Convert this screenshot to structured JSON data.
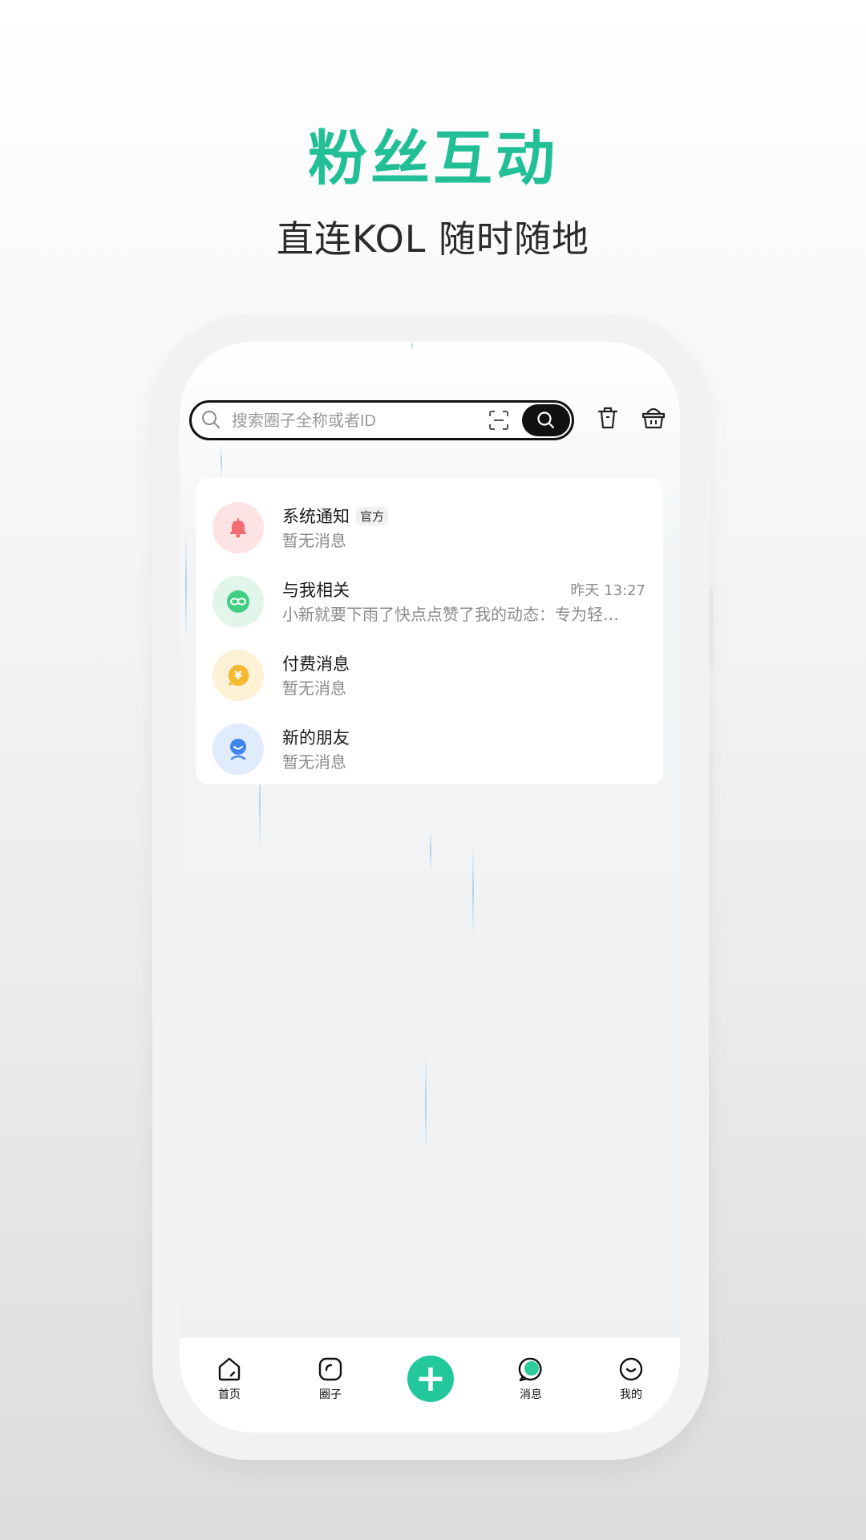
{
  "headline": "粉丝互动",
  "subheadline": "直连KOL  随时随地",
  "search": {
    "placeholder": "搜索圈子全称或者ID"
  },
  "icons": {
    "search": "search-icon",
    "scan": "scan-icon",
    "trash": "trash-icon",
    "basket": "basket-icon"
  },
  "messages": [
    {
      "title": "系统通知",
      "tag": "官方",
      "subtitle": "暂无消息",
      "time": "",
      "icon": "bell-icon",
      "color": "#fde3e4"
    },
    {
      "title": "与我相关",
      "tag": "",
      "subtitle": "小新就要下雨了快点点赞了我的动态：专为轻…",
      "time": "昨天 13:27",
      "icon": "link-icon",
      "color": "#e2f5ea"
    },
    {
      "title": "付费消息",
      "tag": "",
      "subtitle": "暂无消息",
      "time": "",
      "icon": "coin-icon",
      "color": "#fdf1d6"
    },
    {
      "title": "新的朋友",
      "tag": "",
      "subtitle": "暂无消息",
      "time": "",
      "icon": "friend-icon",
      "color": "#e0ebfb"
    }
  ],
  "nav": {
    "home": "首页",
    "circle": "圈子",
    "add": "+",
    "messages": "消息",
    "mine": "我的"
  },
  "colors": {
    "accent": "#22bf97",
    "dark": "#111111"
  }
}
